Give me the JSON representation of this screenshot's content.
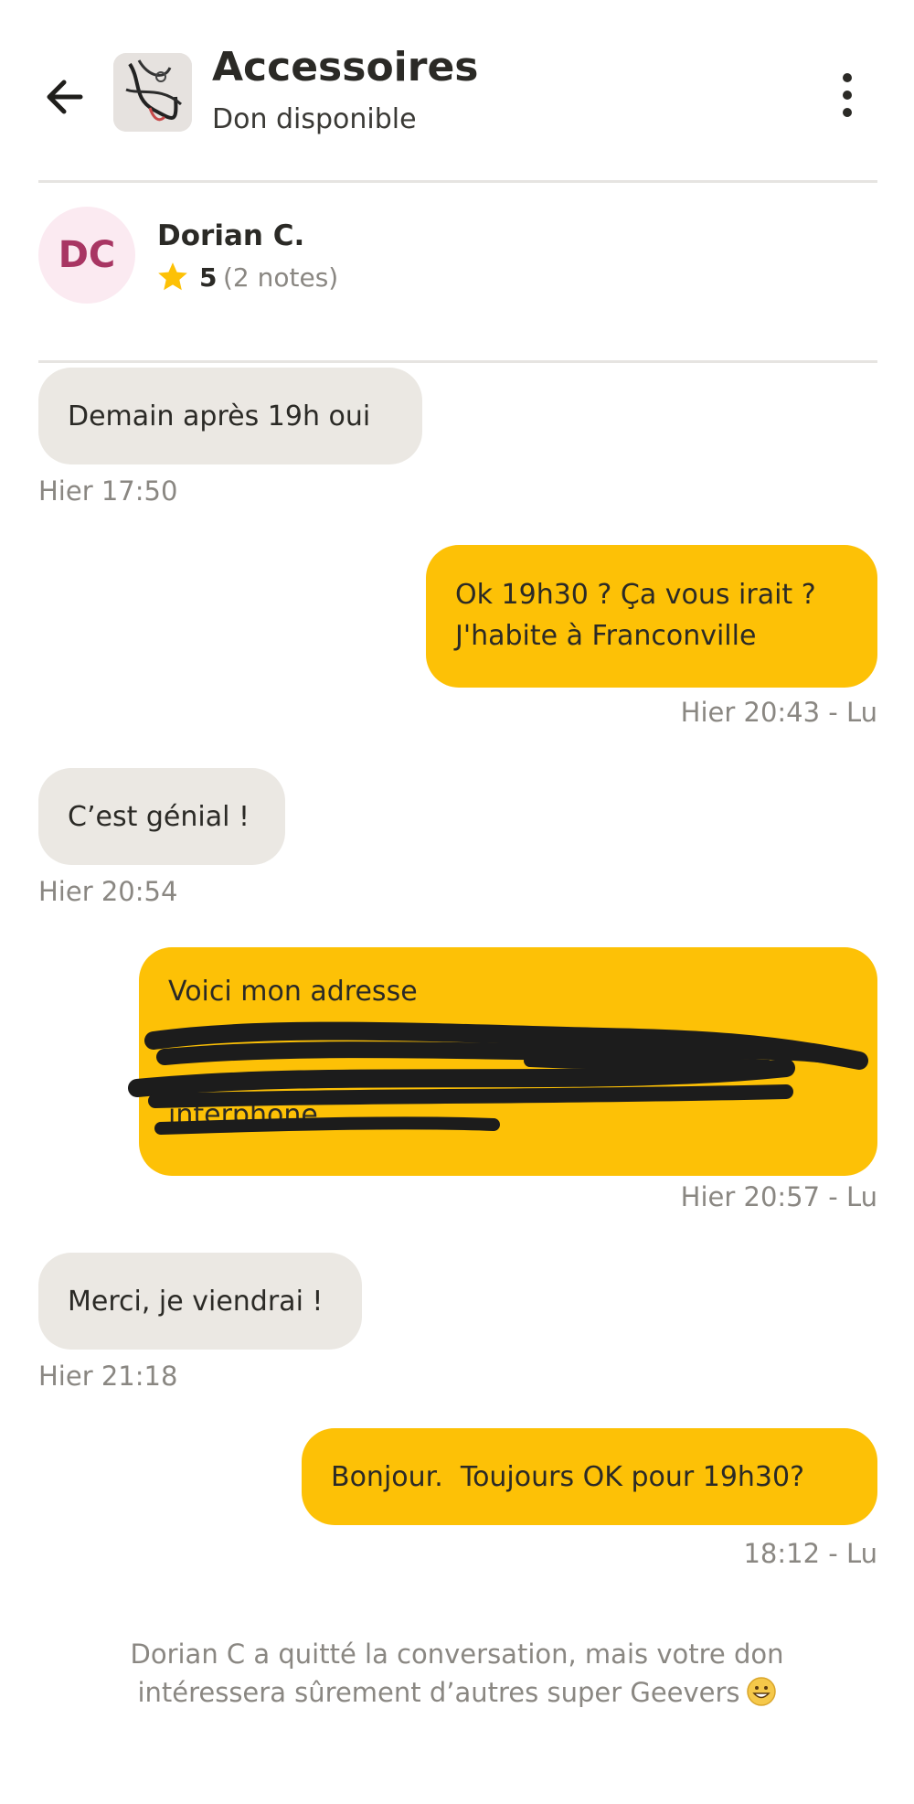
{
  "header": {
    "title": "Accessoires",
    "subtitle": "Don disponible"
  },
  "profile": {
    "initials": "DC",
    "name": "Dorian C.",
    "rating": "5",
    "notes": "(2 notes)"
  },
  "messages": [
    {
      "dir": "in",
      "text": "Demain après 19h oui",
      "meta": "Hier 17:50"
    },
    {
      "dir": "out",
      "lines": [
        "Ok 19h30 ? Ça vous irait ?",
        "J'habite à Franconville"
      ],
      "meta": "Hier 20:43 - Lu"
    },
    {
      "dir": "in",
      "text": "C’est génial !",
      "meta": "Hier 20:54"
    },
    {
      "dir": "out",
      "lines": [
        "Voici mon adresse",
        "interphone"
      ],
      "redacted": true,
      "meta": "Hier 20:57 - Lu"
    },
    {
      "dir": "in",
      "text": "Merci, je viendrai !",
      "meta": "Hier 21:18"
    },
    {
      "dir": "out",
      "text": "Bonjour.  Toujours OK pour 19h30?",
      "meta": "18:12 - Lu"
    }
  ],
  "system_message": {
    "line1": "Dorian C a quitté la conversation, mais votre don",
    "line2": "intéressera sûrement d’autres super Geevers"
  },
  "icons": {
    "back": "back-arrow-icon",
    "more": "more-vertical-icon",
    "star": "star-icon",
    "emoji": "smiling-emoji-icon"
  },
  "colors": {
    "accent": "#fdc106",
    "incoming_bubble": "#ebe8e3",
    "avatar_bg": "#fbeaf1",
    "avatar_text": "#a83663",
    "meta_text": "#8a8782"
  }
}
